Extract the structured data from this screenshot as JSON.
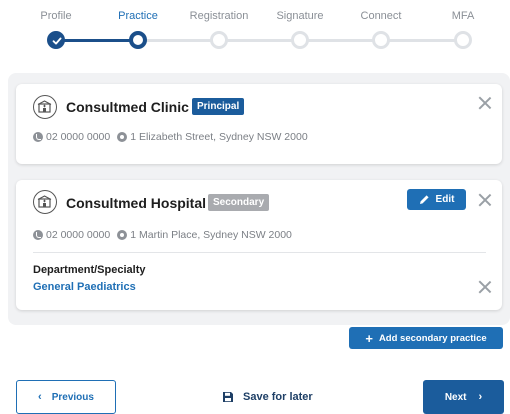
{
  "stepper": {
    "steps": [
      {
        "label": "Profile",
        "state": "done"
      },
      {
        "label": "Practice",
        "state": "current"
      },
      {
        "label": "Registration",
        "state": "pending"
      },
      {
        "label": "Signature",
        "state": "pending"
      },
      {
        "label": "Connect",
        "state": "pending"
      },
      {
        "label": "MFA",
        "state": "pending"
      }
    ]
  },
  "practices": [
    {
      "name": "Consultmed Clinic",
      "badge": "Principal",
      "phone": "02 0000 0000",
      "address": "1 Elizabeth Street, Sydney NSW 2000"
    },
    {
      "name": "Consultmed Hospital",
      "badge": "Secondary",
      "phone": "02 0000 0000",
      "address": "1 Martin Place, Sydney NSW 2000",
      "edit_label": "Edit",
      "department_label": "Department/Specialty",
      "department_value": "General Paediatrics"
    }
  ],
  "actions": {
    "add_secondary_label": "Add secondary practice",
    "previous_label": "Previous",
    "save_label": "Save for later",
    "next_label": "Next"
  },
  "colors": {
    "primary": "#1f6fb5",
    "primary_dark": "#1b4f8a",
    "badge_principal": "#1b5c9c",
    "badge_secondary": "#a9abaf",
    "panel_bg": "#f1f2f4"
  },
  "icons": [
    "check-icon",
    "clinic-icon",
    "phone-icon",
    "location-pin-icon",
    "close-icon",
    "pencil-icon",
    "plus-icon",
    "chevron-left-icon",
    "save-icon",
    "chevron-right-icon"
  ]
}
